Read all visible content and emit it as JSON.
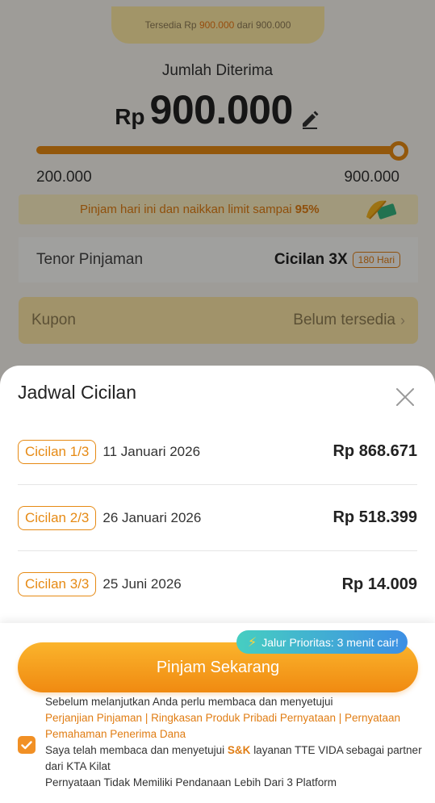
{
  "background": {
    "available_prefix": "Tersedia Rp",
    "available_amount": "900.000",
    "available_middle": "dari",
    "available_limit": "900.000",
    "amount_label": "Jumlah Diterima",
    "currency": "Rp",
    "amount_value": "900.000",
    "edit_icon": "pencil-edit-icon",
    "slider": {
      "min_label": "200.000",
      "max_label": "900.000",
      "value_fraction": 1.0
    },
    "promo_text": "Pinjam hari ini dan naikkan limit sampai",
    "promo_percent": "95%",
    "tenor_label": "Tenor Pinjaman",
    "tenor_value": "Cicilan 3X",
    "tenor_badge": "180 Hari",
    "kupon_label": "Kupon",
    "kupon_value": "Belum tersedia",
    "kupon_chevron": "›"
  },
  "sheet": {
    "title": "Jadwal Cicilan",
    "close_icon": "close-icon",
    "installments": [
      {
        "badge": "Cicilan 1/3",
        "date": "11 Januari 2026",
        "amount": "Rp 868.671"
      },
      {
        "badge": "Cicilan 2/3",
        "date": "26 Januari 2026",
        "amount": "Rp 518.399"
      },
      {
        "badge": "Cicilan 3/3",
        "date": "25 Juni 2026",
        "amount": "Rp 14.009"
      }
    ]
  },
  "bottom": {
    "priority_icon": "lightning-icon",
    "priority_text": "Jalur Prioritas: 3 menit cair!",
    "button_label": "Pinjam Sekarang",
    "terms_line1": "Sebelum melanjutkan Anda perlu membaca dan menyetujui",
    "terms_links": "Perjanjian Pinjaman | Ringkasan Produk Pribadi Pernyataan | Pernyataan Pemahaman Penerima Dana",
    "terms_line3_pre": "Saya telah membaca dan menyetujui",
    "terms_line3_link": "S&K",
    "terms_line3_post": "layanan TTE VIDA sebagai partner dari KTA Kilat",
    "terms_line4": "Pernyataan Tidak Memiliki Pendanaan Lebih Dari 3 Platform",
    "checkbox_checked": true
  },
  "colors": {
    "accent": "#f08a11",
    "accent_light": "#fbb42c",
    "priority_gradient_start": "#46cec1",
    "priority_gradient_end": "#3d8fe4"
  }
}
